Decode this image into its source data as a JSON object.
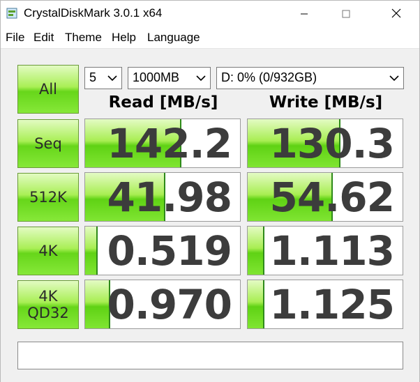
{
  "window": {
    "title": "CrystalDiskMark 3.0.1 x64"
  },
  "menu": [
    "File",
    "Edit",
    "Theme",
    "Help",
    "Language"
  ],
  "controls": {
    "all_label": "All",
    "count": "5",
    "size": "1000MB",
    "drive": "D: 0% (0/932GB)"
  },
  "headers": {
    "read": "Read [MB/s]",
    "write": "Write [MB/s]"
  },
  "rows": [
    {
      "label": [
        "Seq"
      ],
      "read": "142.2",
      "write": "130.3",
      "read_fill": 0.62,
      "write_fill": 0.6
    },
    {
      "label": [
        "512K"
      ],
      "read": "41.98",
      "write": "54.62",
      "read_fill": 0.52,
      "write_fill": 0.55
    },
    {
      "label": [
        "4K"
      ],
      "read": "0.519",
      "write": "1.113",
      "read_fill": 0.08,
      "write_fill": 0.11
    },
    {
      "label": [
        "4K",
        "QD32"
      ],
      "read": "0.970",
      "write": "1.125",
      "read_fill": 0.16,
      "write_fill": 0.11
    }
  ],
  "status": "",
  "colors": {
    "accent_green": "#67d61a",
    "number_text": "#3c3c3c"
  },
  "icons": {
    "app": "crystaldiskmark-app-icon",
    "minimize": "minimize-icon",
    "maximize": "maximize-icon",
    "close": "close-icon"
  }
}
